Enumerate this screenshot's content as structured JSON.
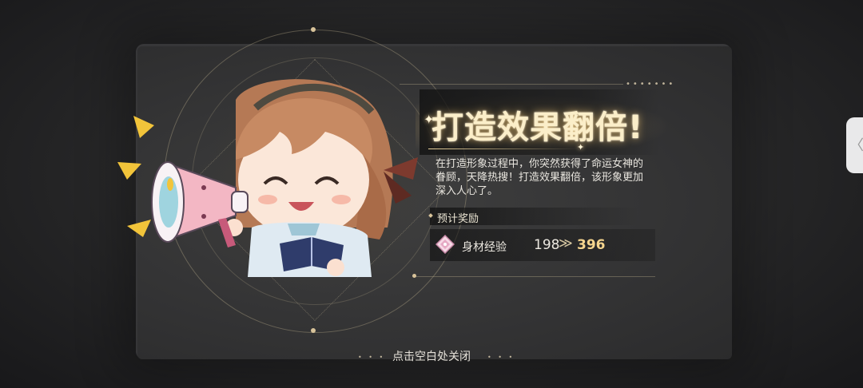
{
  "popup": {
    "title": "打造效果翻倍!",
    "description": "在打造形象过程中，你突然获得了命运女神的眷顾，天降热搜！打造效果翻倍，该形象更加深入人心了。",
    "reward_header": "预计奖励",
    "reward": {
      "icon": "body-exp-diamond-icon",
      "label": "身材经验",
      "old_value": "198",
      "arrow": "≫",
      "new_value": "396"
    },
    "close_hint": "点击空白处关闭"
  },
  "side_handle": {
    "chevron": "〈"
  },
  "colors": {
    "title": "#fbeec9",
    "accent": "#d8c39a",
    "new_value": "#f6d58e",
    "megaphone": "#f3b7c4"
  }
}
